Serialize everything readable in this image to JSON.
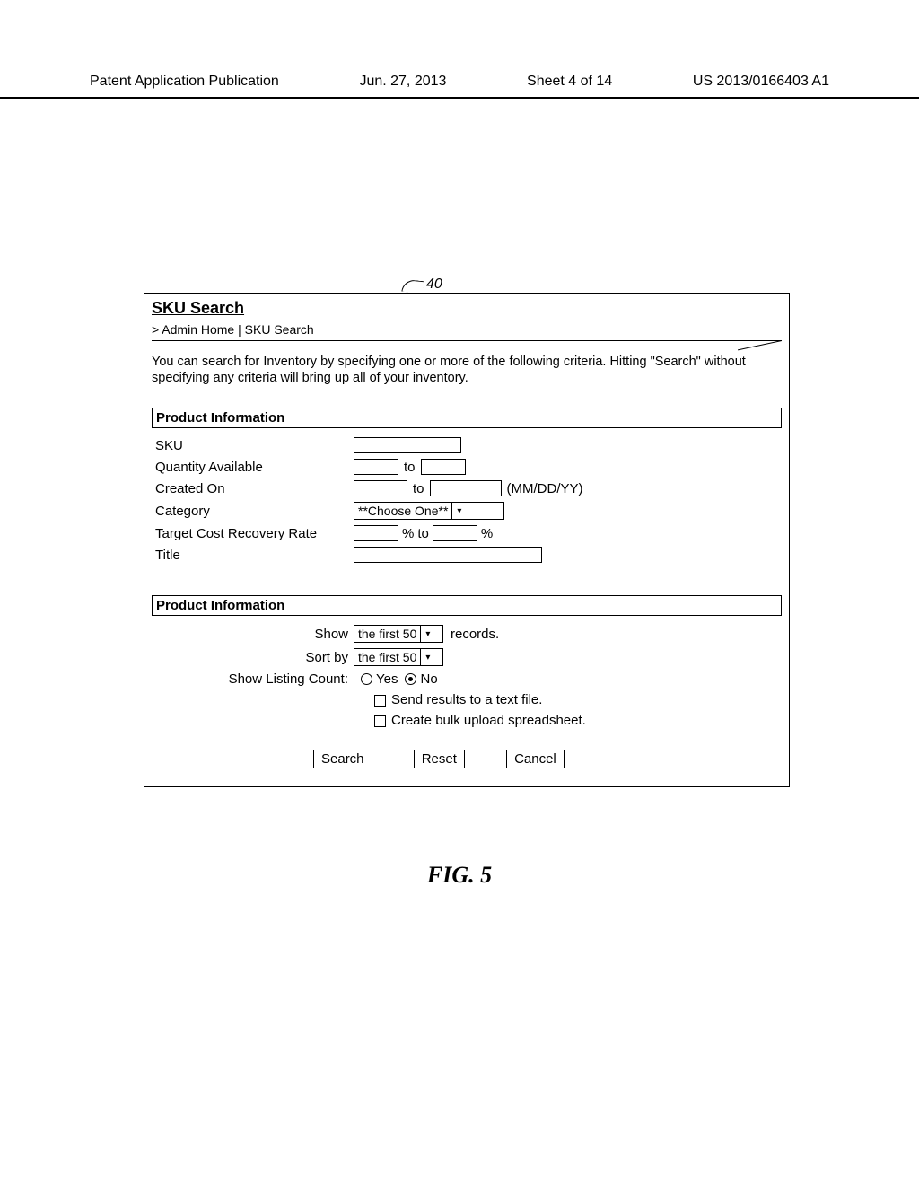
{
  "header": {
    "left": "Patent Application Publication",
    "date": "Jun. 27, 2013",
    "sheet": "Sheet 4 of 14",
    "pubnum": "US 2013/0166403 A1"
  },
  "callout": "40",
  "panel": {
    "title": "SKU Search",
    "breadcrumb_prefix": "> ",
    "breadcrumb_home": "Admin Home",
    "breadcrumb_sep": " | ",
    "breadcrumb_current": "SKU Search",
    "intro": "You can search for Inventory by specifying one or more of the following criteria. Hitting \"Search\" without specifying any criteria will bring up all of your inventory.",
    "section1": "Product Information",
    "section2": "Product Information",
    "labels": {
      "sku": "SKU",
      "qty": "Quantity Available",
      "created": "Created On",
      "created_hint": "(MM/DD/YY)",
      "category": "Category",
      "category_option": "**Choose One**",
      "rate": "Target Cost Recovery Rate",
      "title_field": "Title",
      "to": "to",
      "pct": "%"
    },
    "display": {
      "show_label": "Show",
      "show_option": "the first 50",
      "show_suffix": "records.",
      "sortby_label": "Sort by",
      "sortby_option": "the first 50",
      "listing_label": "Show Listing Count:",
      "yes": "Yes",
      "no": "No",
      "cb1": "Send results to a text file.",
      "cb2": "Create bulk upload spreadsheet."
    },
    "buttons": {
      "search": "Search",
      "reset": "Reset",
      "cancel": "Cancel"
    }
  },
  "figure": "FIG. 5"
}
